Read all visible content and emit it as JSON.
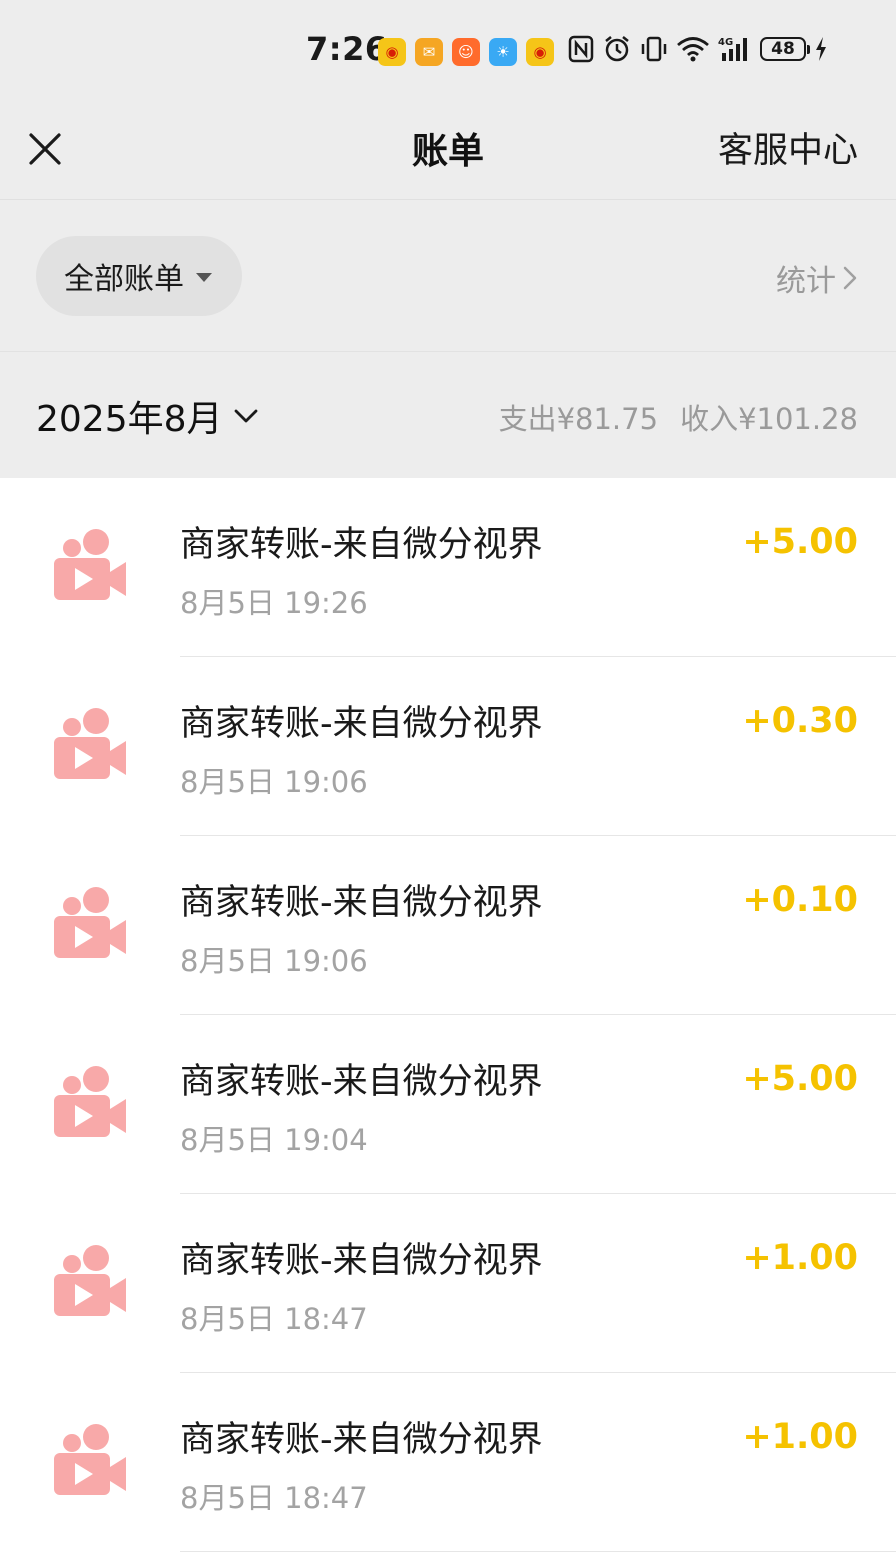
{
  "status_bar": {
    "time": "7:26",
    "notification_icons": [
      "weibo-icon",
      "mail-icon",
      "user-app-icon",
      "weather-icon",
      "weibo-icon"
    ],
    "battery_level": "48",
    "network": "4G"
  },
  "nav": {
    "title": "账单",
    "right_link": "客服中心"
  },
  "filter": {
    "label": "全部账单",
    "stats_link": "统计"
  },
  "month": {
    "label": "2025年8月",
    "expense": "支出¥81.75",
    "income": "收入¥101.28"
  },
  "transactions": [
    {
      "title": "商家转账-来自微分视界",
      "time": "8月5日 19:26",
      "amount": "+5.00"
    },
    {
      "title": "商家转账-来自微分视界",
      "time": "8月5日 19:06",
      "amount": "+0.30"
    },
    {
      "title": "商家转账-来自微分视界",
      "time": "8月5日 19:06",
      "amount": "+0.10"
    },
    {
      "title": "商家转账-来自微分视界",
      "time": "8月5日 19:04",
      "amount": "+5.00"
    },
    {
      "title": "商家转账-来自微分视界",
      "time": "8月5日 18:47",
      "amount": "+1.00"
    },
    {
      "title": "商家转账-来自微分视界",
      "time": "8月5日 18:47",
      "amount": "+1.00"
    }
  ],
  "colors": {
    "amount_income": "#f5c200",
    "icon_pink": "#f8a9a9",
    "header_bg": "#ededed"
  }
}
